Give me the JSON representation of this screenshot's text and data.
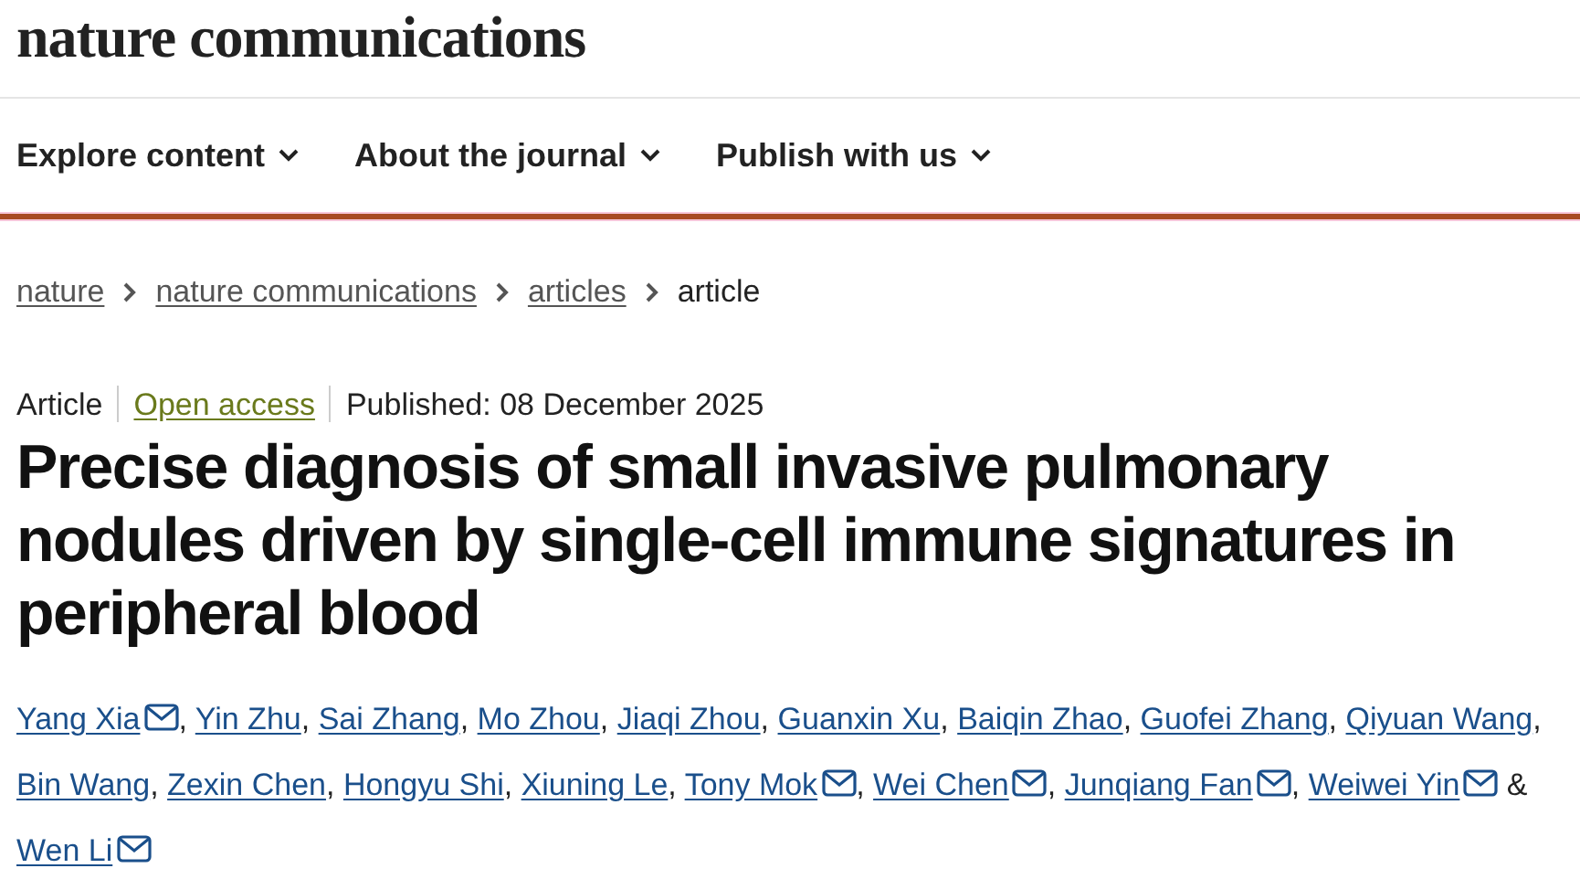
{
  "logo": "nature communications",
  "nav": [
    {
      "label": "Explore content"
    },
    {
      "label": "About the journal"
    },
    {
      "label": "Publish with us"
    }
  ],
  "breadcrumb": [
    {
      "label": "nature",
      "link": true
    },
    {
      "label": "nature communications",
      "link": true
    },
    {
      "label": "articles",
      "link": true
    },
    {
      "label": "article",
      "link": false
    }
  ],
  "meta": [
    {
      "label": "Article",
      "kind": "type"
    },
    {
      "label": "Open access",
      "kind": "access"
    },
    {
      "label": "Published: 08 December 2025",
      "kind": "date"
    }
  ],
  "title": "Precise diagnosis of small invasive pulmonary nodules driven by single-cell immune signatures in peripheral blood",
  "authors": [
    {
      "name": "Yang Xia",
      "email": true,
      "after": ","
    },
    {
      "name": "Yin Zhu",
      "email": false,
      "after": ","
    },
    {
      "name": "Sai Zhang",
      "email": false,
      "after": ","
    },
    {
      "name": "Mo Zhou",
      "email": false,
      "after": ","
    },
    {
      "name": "Jiaqi Zhou",
      "email": false,
      "after": ","
    },
    {
      "name": "Guanxin Xu",
      "email": false,
      "after": ","
    },
    {
      "name": "Baiqin Zhao",
      "email": false,
      "after": ","
    },
    {
      "name": "Guofei Zhang",
      "email": false,
      "after": ","
    },
    {
      "name": "Qiyuan Wang",
      "email": false,
      "after": ","
    },
    {
      "name": "Bin Wang",
      "email": false,
      "after": ","
    },
    {
      "name": "Zexin Chen",
      "email": false,
      "after": ","
    },
    {
      "name": "Hongyu Shi",
      "email": false,
      "after": ","
    },
    {
      "name": "Xiuning Le",
      "email": false,
      "after": ","
    },
    {
      "name": "Tony Mok",
      "email": true,
      "after": ","
    },
    {
      "name": "Wei Chen",
      "email": true,
      "after": ","
    },
    {
      "name": "Junqiang Fan",
      "email": true,
      "after": ","
    },
    {
      "name": "Weiwei Yin",
      "email": true,
      "after": "&"
    },
    {
      "name": "Wen Li",
      "email": true
    }
  ]
}
